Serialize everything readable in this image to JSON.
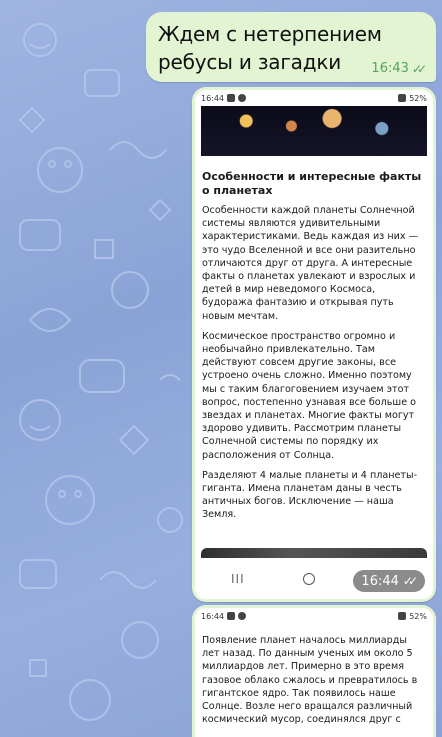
{
  "message": {
    "text": "Ждем с нетерпением ребусы и загадки",
    "time": "16:43",
    "read_status": "✓✓"
  },
  "screenshot1": {
    "statusbar_time": "16:44",
    "statusbar_right": "52%",
    "article_title": "Особенности и интересные факты о планетах",
    "paragraphs": [
      "Особенности каждой планеты Солнечной системы являются удивительными характеристиками. Ведь каждая из них — это чудо Вселенной и все они разительно отличаются друг от друга. А интересные факты о планетах увлекают и взрослых и детей в мир неведомого Космоса, будоража фантазию и открывая путь новым мечтам.",
      "Космическое пространство огромно и необычайно привлекательно. Там действуют совсем другие законы, все устроено очень сложно. Именно поэтому мы с таким благоговением изучаем этот вопрос, постепенно узнавая все больше о звездах и планетах. Многие факты могут здорово удивить. Рассмотрим планеты Солнечной системы по порядку их расположения от Солнца.",
      "Разделяют 4 малые планеты и 4 планеты-гиганта. Имена планетам даны в честь античных богов. Исключение — наша Земля."
    ],
    "nav_lines": "III",
    "photo_time": "16:44",
    "photo_read_status": "✓✓"
  },
  "screenshot2": {
    "statusbar_time": "16:44",
    "statusbar_right": "52%",
    "paragraph": "Появление планет началось миллиарды лет назад. По данным ученых им около 5 миллиардов лет. Примерно в это время газовое облако сжалось и превратилось в гигантское ядро. Так появилось наше Солнце. Возле него вращался различный космический мусор, соединялся друг с"
  },
  "colors": {
    "bubble": "#e3f4d2",
    "time_green": "#55a35a",
    "chat_bg": "#8fa8d8"
  }
}
